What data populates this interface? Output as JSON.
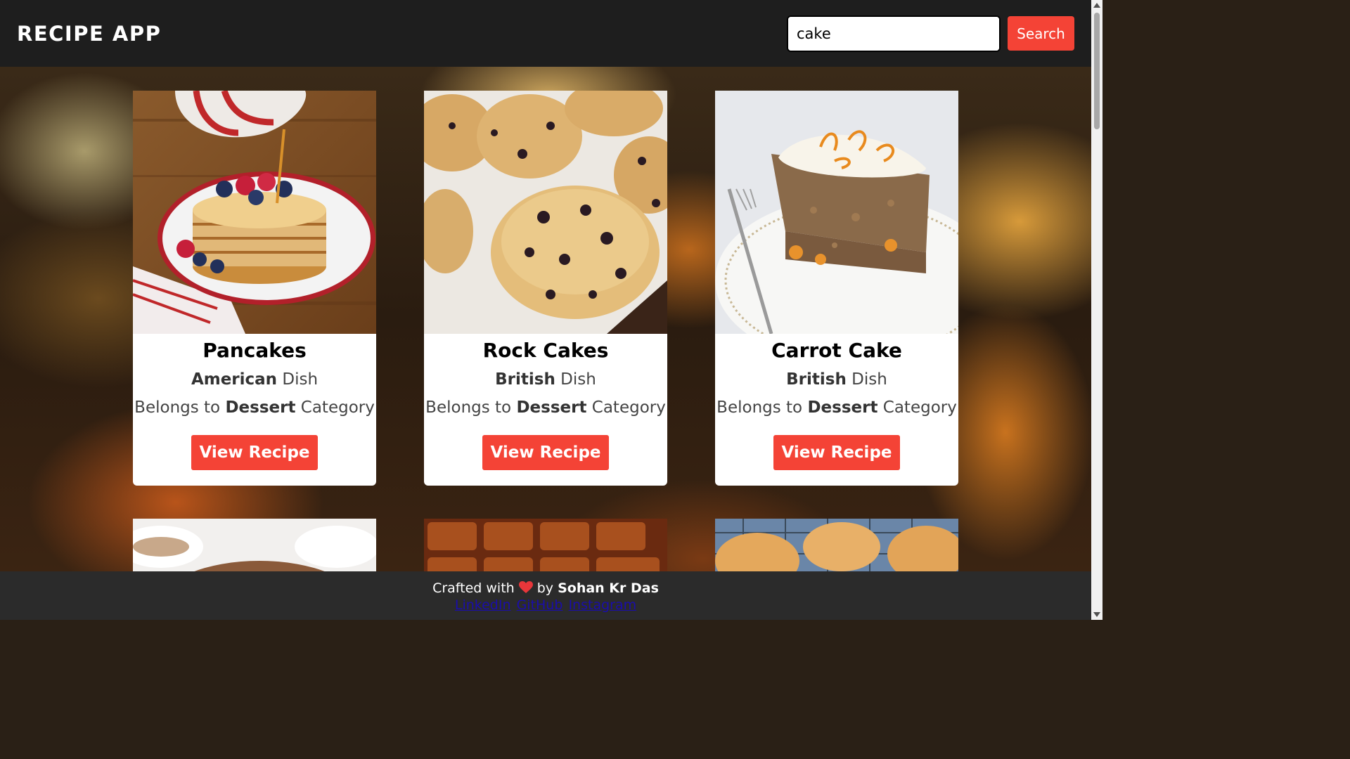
{
  "header": {
    "title": "RECIPE APP",
    "search": {
      "value": "cake",
      "placeholder": ""
    },
    "search_button": "Search"
  },
  "recipes": [
    {
      "name": "Pancakes",
      "area": "American",
      "area_suffix": "Dish",
      "category_prefix": "Belongs to",
      "category": "Dessert",
      "category_suffix": "Category",
      "button": "View Recipe"
    },
    {
      "name": "Rock Cakes",
      "area": "British",
      "area_suffix": "Dish",
      "category_prefix": "Belongs to",
      "category": "Dessert",
      "category_suffix": "Category",
      "button": "View Recipe"
    },
    {
      "name": "Carrot Cake",
      "area": "British",
      "area_suffix": "Dish",
      "category_prefix": "Belongs to",
      "category": "Dessert",
      "category_suffix": "Category",
      "button": "View Recipe"
    }
  ],
  "footer": {
    "crafted": "Crafted with",
    "by": "by",
    "author": "Sohan Kr Das",
    "links": [
      "LinkedIn",
      "GitHub",
      "Instagram"
    ]
  },
  "colors": {
    "accent": "#f44336",
    "header_bg": "#1e1e1e",
    "footer_bg": "#2b2b2b"
  }
}
